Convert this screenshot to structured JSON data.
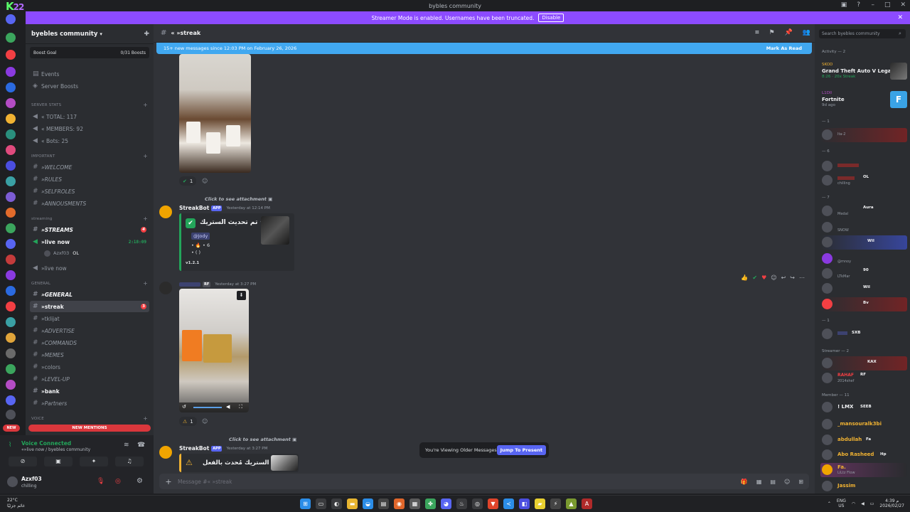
{
  "window": {
    "title": "bybles community",
    "logo_text": "K",
    "logo_num": "22"
  },
  "banner": {
    "text": "Streamer Mode is enabled. Usernames have been truncated.",
    "button": "Disable"
  },
  "sidebar": {
    "server_name": "byebles community",
    "boost_goal": {
      "label": "Boost Goal",
      "value": "0/31 Boosts"
    },
    "top_items": [
      "Events",
      "Server Boosts"
    ],
    "categories": {
      "server_stats": "SERVER STATS",
      "important": "IMPORTANT",
      "streaming": "streaming",
      "general": "GENERAL",
      "voice": "VOICE"
    },
    "stats": [
      "« TOTAL: 117",
      "« MEMBERS: 92",
      "« Bots: 25"
    ],
    "important_channels": [
      "»WELCOME",
      "»RULES",
      "»SELFROLES",
      "»ANNOUSMENTS"
    ],
    "streaming_channels": [
      {
        "name": "»STREAMS",
        "badge": "4"
      },
      {
        "name": "»live now",
        "time": "2:18:09"
      },
      {
        "name": "»live now"
      }
    ],
    "voice_user": {
      "name": "Azxf03",
      "tag": "OL"
    },
    "general_channels": [
      {
        "name": "»GENERAL"
      },
      {
        "name": "»streak",
        "badge": "3"
      },
      {
        "name": "»tklijat"
      },
      {
        "name": "»ADVERTISE"
      },
      {
        "name": "»COMMANDS"
      },
      {
        "name": "»MEMES"
      },
      {
        "name": "»colors"
      },
      {
        "name": "»LEVEL-UP"
      },
      {
        "name": "»bank"
      },
      {
        "name": "»Partners"
      }
    ],
    "new_pill": "NEW",
    "new_mentions": "NEW MENTIONS"
  },
  "voice": {
    "status": "Voice Connected",
    "channel": "«»live now / byebles community"
  },
  "user": {
    "name": "Azxf03",
    "status": "chilling"
  },
  "chat": {
    "channel_name": "« »streak",
    "new_messages_bar": "15+ new messages since 12:03 PM on February 26, 2026",
    "mark_as_read": "Mark As Read",
    "messages": [
      {
        "reply_text": "Click to see attachment",
        "author": "StreakBot",
        "app_tag": "APP",
        "timestamp": "Yesterday at 12:14 PM",
        "embed_title": "تم تحديث الستريك •",
        "embed_mention": "@Jody",
        "embed_line1": "• 🔥 • 6",
        "embed_line2": "• ( )",
        "embed_footer": "v1.2.1"
      },
      {
        "timestamp": "Yesterday at 3:27 PM",
        "tag": "RF"
      },
      {
        "reply_text": "Click to see attachment",
        "author": "StreakBot",
        "app_tag": "APP",
        "timestamp": "Yesterday at 3:27 PM",
        "embed_title": "الستريك مُحدث بالفعل"
      }
    ],
    "reaction_count": "1",
    "older_messages": "You're Viewing Older Messages",
    "jump_to_present": "Jump To Present",
    "composer_placeholder": "Message #« »streak"
  },
  "members": {
    "search_placeholder": "Search byebles community",
    "activity_header": "Activity — 2",
    "activities": [
      {
        "label": "SKOD",
        "game": "Grand Theft Auto V Lega…",
        "meta": "8:26 · 20x Streak"
      },
      {
        "label": "L1DII",
        "game": "Fortnite",
        "meta": "9d ago"
      }
    ],
    "groups": [
      {
        "title": "— 1",
        "y": 0
      },
      {
        "title": "— 6",
        "y": 0
      },
      {
        "title": "— 7",
        "y": 0
      },
      {
        "title": "— 1",
        "y": 0
      },
      {
        "title": "Streamer — 2",
        "y": 0
      },
      {
        "title": "Member — 11",
        "y": 0
      }
    ],
    "rows": [
      {
        "name": "",
        "sub": "Ita-2",
        "color": "#dbdee1"
      },
      {
        "name": "",
        "sub": "",
        "color": "#f23f43"
      },
      {
        "name": "",
        "sub": "chilling",
        "tag": "OL",
        "color": "#f23f43"
      },
      {
        "name": "",
        "sub": "Medal",
        "tag": "Aura",
        "color": "#dbdee1"
      },
      {
        "name": "",
        "sub": "SNOW",
        "color": "#dbdee1"
      },
      {
        "name": "",
        "sub": "",
        "tag": "Wil",
        "color": "#dbdee1"
      },
      {
        "name": "",
        "sub": "@mnoy",
        "color": "#dbdee1"
      },
      {
        "name": "",
        "sub": "LTkMar",
        "tag": "90",
        "color": "#dbdee1"
      },
      {
        "name": "",
        "sub": "",
        "tag": "Wil",
        "color": "#f23f43"
      },
      {
        "name": "",
        "sub": "",
        "tag": "Bv",
        "color": "#f23f43"
      },
      {
        "name": "",
        "sub": "",
        "tag": "SXB",
        "color": "#5865f2"
      },
      {
        "name": "",
        "sub": "",
        "tag": "KAX",
        "color": "#f23f43"
      },
      {
        "name": "RAHAF",
        "sub": "2014shef",
        "tag": "RF",
        "color": "#f23f43"
      },
      {
        "name": "! LMX",
        "sub": "",
        "tag": "SEEB",
        "color": "#f2f3f5"
      },
      {
        "name": "_mansouralk3bi",
        "sub": "",
        "color": "#f0b232"
      },
      {
        "name": "abdullah",
        "sub": "",
        "tag": "Fa",
        "color": "#f0b232"
      },
      {
        "name": "Abo Rasheed",
        "sub": "",
        "tag": "Hp",
        "color": "#f0b232"
      },
      {
        "name": "Fa.",
        "sub": "LiLtz Flow",
        "color": "#f0b232"
      },
      {
        "name": "Jassim",
        "sub": "",
        "color": "#f0b232"
      }
    ]
  },
  "taskbar": {
    "weather_temp": "22°C",
    "weather_desc": "غائم جزئيًا",
    "lang_top": "ENG",
    "lang_bottom": "US",
    "time": "4:39 م",
    "date": "2026/02/27"
  }
}
